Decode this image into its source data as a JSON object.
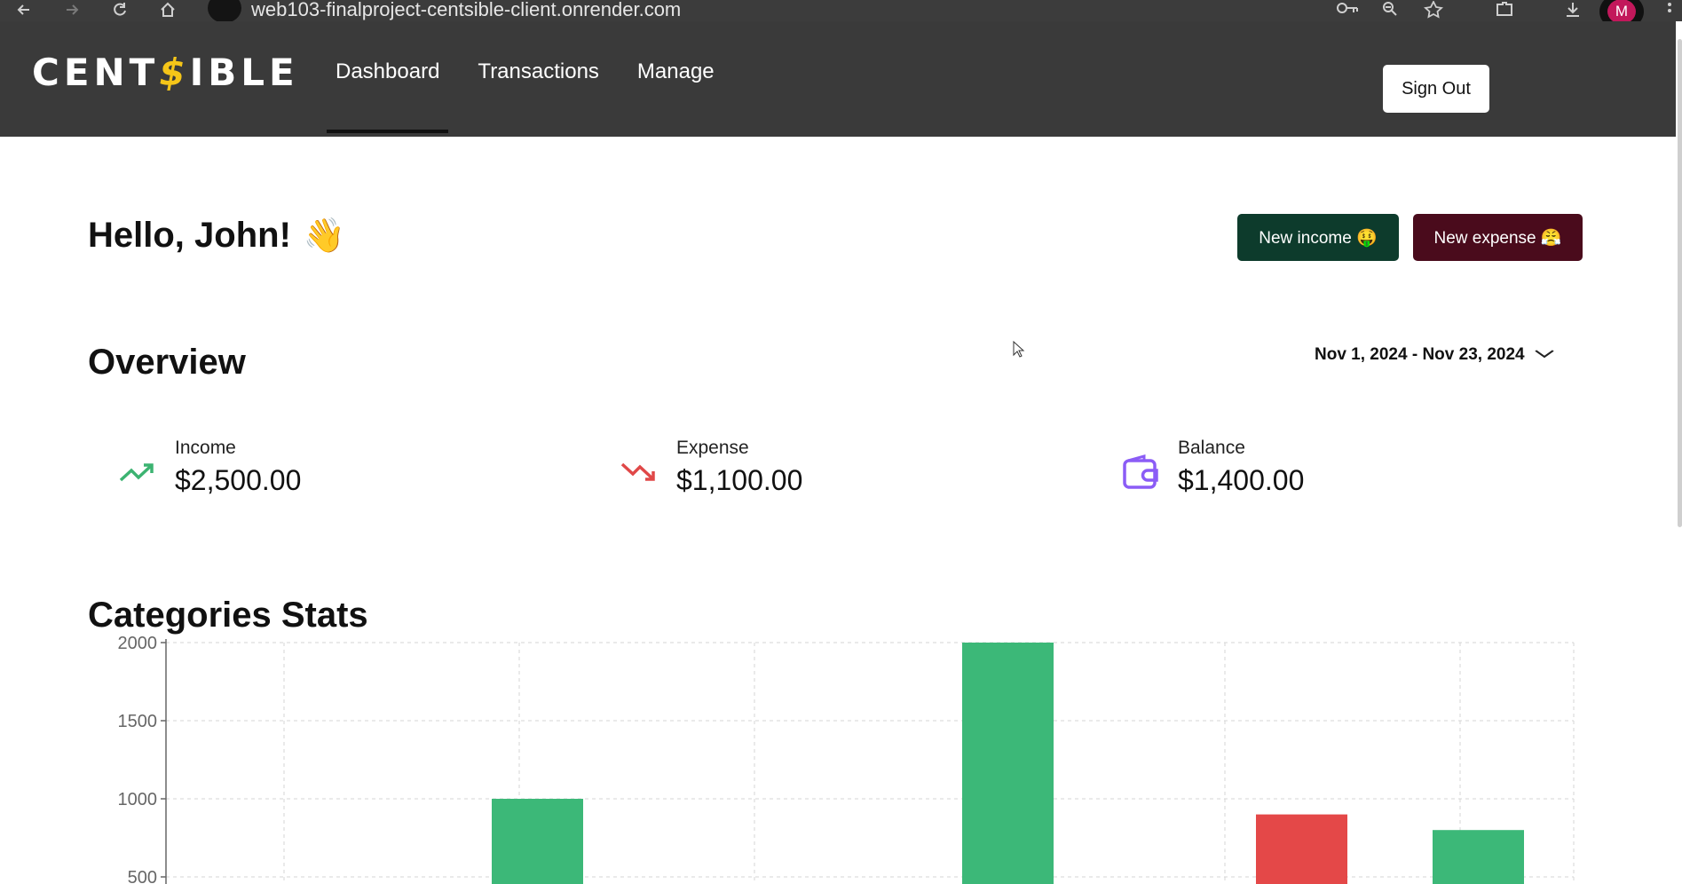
{
  "browser": {
    "url": "web103-finalproject-centsible-client.onrender.com",
    "profile_initial": "M",
    "icons": [
      "back-icon",
      "forward-icon",
      "reload-icon",
      "home-icon",
      "site-info-icon",
      "key-icon",
      "zoom-icon",
      "star-icon",
      "extensions-icon",
      "download-icon",
      "menu-icon"
    ]
  },
  "header": {
    "logo_text_left": "CENT",
    "logo_text_s": "$",
    "logo_text_right": "IBLE",
    "nav": [
      {
        "label": "Dashboard",
        "active": true
      },
      {
        "label": "Transactions",
        "active": false
      },
      {
        "label": "Manage",
        "active": false
      }
    ],
    "signout_label": "Sign Out"
  },
  "greeting": {
    "text": "Hello, John!",
    "emoji": "👋"
  },
  "actions": {
    "new_income": "New income 🤑",
    "new_expense": "New expense 😤"
  },
  "overview": {
    "title": "Overview",
    "date_range": "Nov 1, 2024 - Nov 23, 2024",
    "stats": [
      {
        "label": "Income",
        "value": "$2,500.00",
        "icon": "trending-up-icon",
        "color": "#3cb371"
      },
      {
        "label": "Expense",
        "value": "$1,100.00",
        "icon": "trending-down-icon",
        "color": "#e04848"
      },
      {
        "label": "Balance",
        "value": "$1,400.00",
        "icon": "wallet-icon",
        "color": "#8b5cf6"
      }
    ]
  },
  "categories": {
    "title": "Categories Stats"
  },
  "chart_data": {
    "type": "bar",
    "title": "",
    "xlabel": "",
    "ylabel": "",
    "ylim": [
      0,
      2000
    ],
    "yticks": [
      2000,
      1500,
      1000,
      500
    ],
    "grid": true,
    "bars": [
      {
        "slot": 1,
        "value": 1000,
        "color": "#3cb878"
      },
      {
        "slot": 3,
        "value": 2000,
        "color": "#3cb878"
      },
      {
        "slot": 4.4,
        "value": 900,
        "color": "#e44848"
      },
      {
        "slot": 5,
        "value": 800,
        "color": "#3cb878"
      }
    ]
  }
}
